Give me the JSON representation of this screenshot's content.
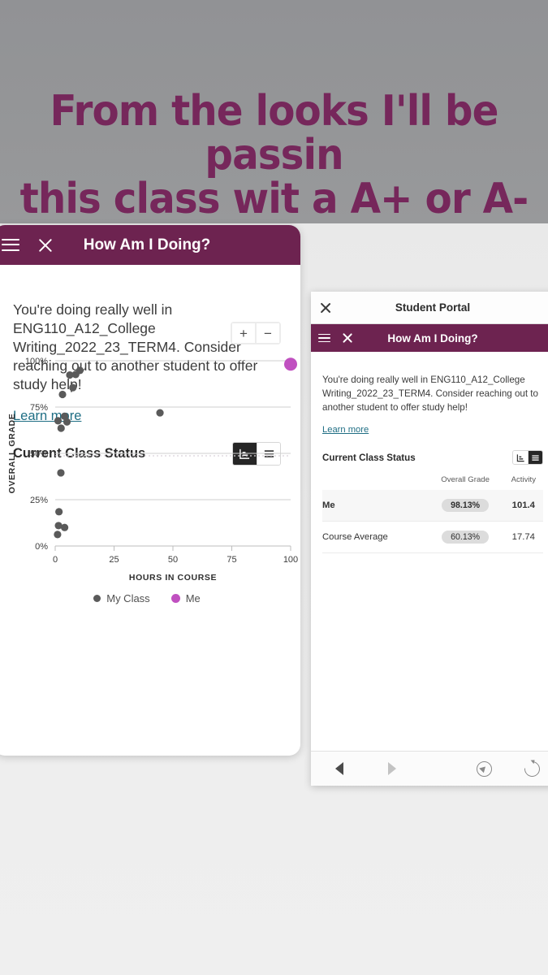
{
  "meme": {
    "line1": "From the looks I'll be passin",
    "line2": "this class wit a A+ or A-",
    "color": "#76275b"
  },
  "panel_one": {
    "header": {
      "menu_icon": "hamburger-icon",
      "close_icon": "close-icon",
      "title": "How Am I Doing?",
      "background": "#6d2350"
    },
    "message": "You're doing really well in ENG110_A12_College Writing_2022_23_TERM4. Consider reaching out to another student to offer study help!",
    "learn_more": "Learn more",
    "section_title": "Current Class Status",
    "view_toggle": {
      "chart_label": "chart-view",
      "list_label": "list-view",
      "selected": "chart"
    },
    "zoom_controls": {
      "zoom_in": "+",
      "zoom_out": "−"
    }
  },
  "panel_two": {
    "browser_header": {
      "close_icon": "close-icon",
      "title": "Student Portal"
    },
    "header": {
      "menu_icon": "hamburger-icon",
      "close_icon": "close-icon",
      "title": "How Am I Doing?"
    },
    "message": "You're doing really well in ENG110_A12_College Writing_2022_23_TERM4. Consider reaching out to another student to offer study help!",
    "learn_more": "Learn more",
    "section_title": "Current Class Status",
    "view_toggle": {
      "chart_label": "chart-view",
      "list_label": "list-view",
      "selected": "list"
    },
    "table": {
      "columns": [
        "",
        "Overall Grade",
        "Activity"
      ],
      "rows": [
        {
          "label": "Me",
          "overall_grade": "98.13%",
          "activity": "101.4",
          "highlight": true
        },
        {
          "label": "Course Average",
          "overall_grade": "60.13%",
          "activity": "17.74",
          "highlight": false
        }
      ]
    },
    "browser_nav": {
      "back_icon": "back-arrow-icon",
      "forward_icon": "forward-arrow-icon",
      "compass_icon": "compass-icon",
      "reload_icon": "reload-icon"
    }
  },
  "chart_data": {
    "type": "scatter",
    "title": "Current Class Status",
    "xlabel": "HOURS IN COURSE",
    "ylabel": "OVERALL GRADE",
    "xlim": [
      0,
      100
    ],
    "ylim": [
      0,
      100
    ],
    "xticks": [
      0,
      25,
      50,
      75,
      100
    ],
    "yticks": [
      0,
      25,
      50,
      75,
      100
    ],
    "ytick_labels": [
      "0%",
      "25%",
      "50%",
      "75%",
      "100%"
    ],
    "grid": true,
    "legend_position": "bottom",
    "series": [
      {
        "name": "My Class",
        "color": "#5a5a5a",
        "points": [
          {
            "x": 10.5,
            "y": 94.8
          },
          {
            "x": 6.2,
            "y": 92.3
          },
          {
            "x": 8.7,
            "y": 92.6
          },
          {
            "x": 7.5,
            "y": 85.5
          },
          {
            "x": 3.1,
            "y": 81.8
          },
          {
            "x": 44.5,
            "y": 71.9
          },
          {
            "x": 4.0,
            "y": 70.0
          },
          {
            "x": 1.2,
            "y": 67.6
          },
          {
            "x": 5.0,
            "y": 67.0
          },
          {
            "x": 2.5,
            "y": 63.6
          },
          {
            "x": 2.4,
            "y": 39.5
          },
          {
            "x": 1.6,
            "y": 18.5
          },
          {
            "x": 1.4,
            "y": 11.0
          },
          {
            "x": 4.0,
            "y": 10.0
          },
          {
            "x": 1.0,
            "y": 6.2
          }
        ]
      },
      {
        "name": "Me",
        "color": "#c050c0",
        "points": [
          {
            "x": 100,
            "y": 98.13
          }
        ]
      }
    ]
  }
}
